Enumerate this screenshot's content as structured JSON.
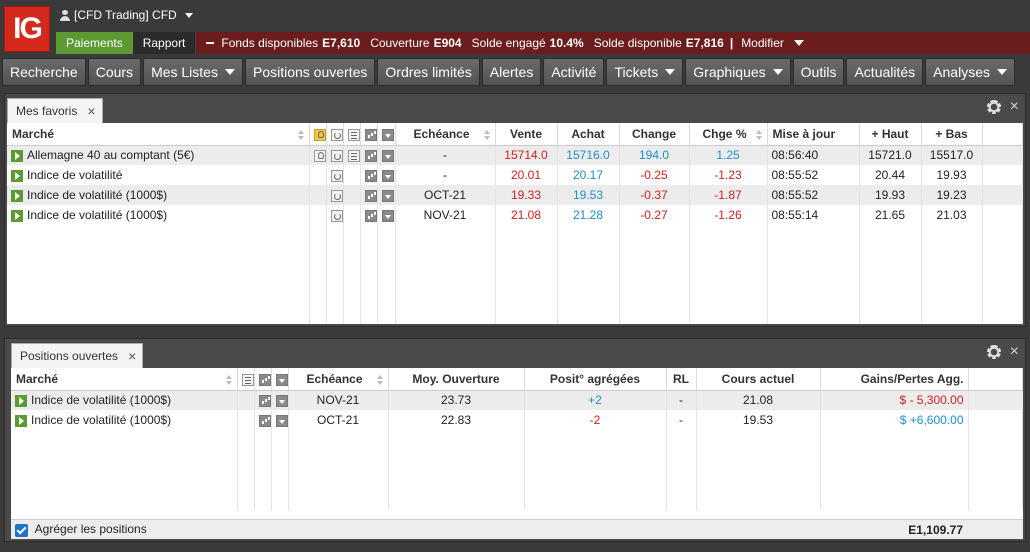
{
  "header": {
    "logo_text": "IG",
    "account_label": "[CFD Trading] CFD",
    "paiements_label": "Paiements",
    "rapport_label": "Rapport",
    "funds": {
      "fonds_label": "Fonds disponibles",
      "fonds_value": "E7,610",
      "couverture_label": "Couverture",
      "couverture_value": "E904",
      "solde_engage_label": "Solde engagé",
      "solde_engage_value": "10.4%",
      "solde_dispo_label": "Solde disponible",
      "solde_dispo_value": "E7,816",
      "separator": "|",
      "modifier_label": "Modifier"
    }
  },
  "nav": {
    "items": [
      {
        "label": "Recherche",
        "caret": false
      },
      {
        "label": "Cours",
        "caret": false
      },
      {
        "label": "Mes Listes",
        "caret": true
      },
      {
        "label": "Positions ouvertes",
        "caret": false
      },
      {
        "label": "Ordres limités",
        "caret": false
      },
      {
        "label": "Alertes",
        "caret": false
      },
      {
        "label": "Activité",
        "caret": false
      },
      {
        "label": "Tickets",
        "caret": true
      },
      {
        "label": "Graphiques",
        "caret": true
      },
      {
        "label": "Outils",
        "caret": false
      },
      {
        "label": "Actualités",
        "caret": false
      },
      {
        "label": "Analyses",
        "caret": true
      }
    ]
  },
  "favoris": {
    "tab_label": "Mes favoris",
    "close_symbol": "×",
    "columns": {
      "marche": "Marché",
      "echeance": "Echéance",
      "vente": "Vente",
      "achat": "Achat",
      "change": "Change",
      "chge_pct": "Chge %",
      "maj": "Mise à jour",
      "haut": "+ Haut",
      "bas": "+ Bas"
    },
    "rows": [
      {
        "market": "Allemagne 40 au comptant (5€)",
        "echeance": "-",
        "vente": "15714.0",
        "achat": "15716.0",
        "change": "194.0",
        "chge_pct": "1.25",
        "maj": "08:56:40",
        "haut": "15721.0",
        "bas": "15517.0",
        "direction": "up",
        "bulb": true,
        "doc": true
      },
      {
        "market": "Indice de volatilité",
        "echeance": "-",
        "vente": "20.01",
        "achat": "20.17",
        "change": "-0.25",
        "chge_pct": "-1.23",
        "maj": "08:55:52",
        "haut": "20.44",
        "bas": "19.93",
        "direction": "down",
        "bulb": false,
        "doc": false
      },
      {
        "market": "Indice de volatilité (1000$)",
        "echeance": "OCT-21",
        "vente": "19.33",
        "achat": "19.53",
        "change": "-0.37",
        "chge_pct": "-1.87",
        "maj": "08:55:52",
        "haut": "19.93",
        "bas": "19.23",
        "direction": "down",
        "bulb": false,
        "doc": false
      },
      {
        "market": "Indice de volatilité (1000$)",
        "echeance": "NOV-21",
        "vente": "21.08",
        "achat": "21.28",
        "change": "-0.27",
        "chge_pct": "-1.26",
        "maj": "08:55:14",
        "haut": "21.65",
        "bas": "21.03",
        "direction": "down",
        "bulb": false,
        "doc": false
      }
    ]
  },
  "positions": {
    "tab_label": "Positions ouvertes",
    "close_symbol": "×",
    "columns": {
      "marche": "Marché",
      "echeance": "Echéance",
      "moy_ouverture": "Moy. Ouverture",
      "posit_agregees": "Posit° agrégées",
      "rl": "RL",
      "cours_actuel": "Cours actuel",
      "gains_pertes": "Gains/Pertes Agg."
    },
    "rows": [
      {
        "market": "Indice de volatilité (1000$)",
        "echeance": "NOV-21",
        "moy_ouverture": "23.73",
        "posit": "+2",
        "rl": "-",
        "cours": "21.08",
        "gains": "$ - 5,300.00",
        "posit_color": "blue",
        "gains_color": "red"
      },
      {
        "market": "Indice de volatilité (1000$)",
        "echeance": "OCT-21",
        "moy_ouverture": "22.83",
        "posit": "-2",
        "rl": "-",
        "cours": "19.53",
        "gains": "$ +6,600.00",
        "posit_color": "red",
        "gains_color": "blue"
      }
    ],
    "footer": {
      "aggregate_label": "Agréger les positions",
      "total": "E1,109.77"
    }
  },
  "colors": {
    "accent_green": "#5c9a32",
    "logo_red": "#d42a1e",
    "funds_bar": "#6b1c1c",
    "price_red": "#d21f1f",
    "price_blue": "#1f8fc9"
  }
}
